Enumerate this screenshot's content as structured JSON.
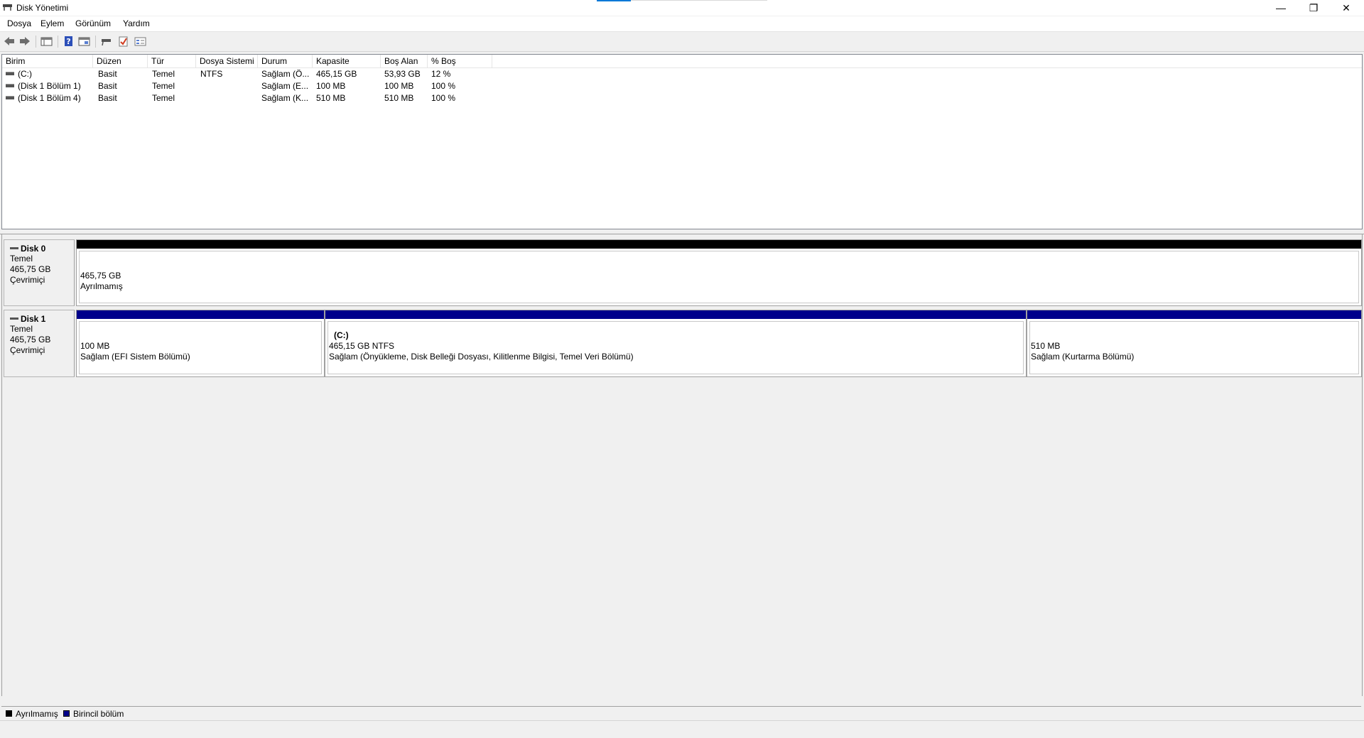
{
  "window": {
    "title": "Disk Yönetimi",
    "buttons": {
      "minimize": "—",
      "restore": "❐",
      "close": "✕"
    }
  },
  "menu": {
    "items": [
      "Dosya",
      "Eylem",
      "Görünüm",
      "Yardım"
    ]
  },
  "toolbar": {
    "icons": [
      "back-icon",
      "forward-icon",
      "console-tree-icon",
      "help-icon",
      "properties-icon",
      "connect-disk-icon",
      "check-icon",
      "settings-icon"
    ]
  },
  "volumes": {
    "columns": [
      "Birim",
      "Düzen",
      "Tür",
      "Dosya Sistemi",
      "Durum",
      "Kapasite",
      "Boş Alan",
      "% Boş"
    ],
    "rows": [
      [
        "(C:)",
        "Basit",
        "Temel",
        "NTFS",
        "Sağlam (Ö...",
        "465,15 GB",
        "53,93 GB",
        "12 %"
      ],
      [
        "(Disk 1 Bölüm 1)",
        "Basit",
        "Temel",
        "",
        "Sağlam (E...",
        "100 MB",
        "100 MB",
        "100 %"
      ],
      [
        "(Disk 1 Bölüm 4)",
        "Basit",
        "Temel",
        "",
        "Sağlam (K...",
        "510 MB",
        "510 MB",
        "100 %"
      ]
    ]
  },
  "disks": [
    {
      "name": "Disk 0",
      "type": "Temel",
      "size": "465,75 GB",
      "status": "Çevrimiçi",
      "partitions": [
        {
          "label": "",
          "size": "465,75 GB",
          "status": "Ayrılmamış"
        }
      ]
    },
    {
      "name": "Disk 1",
      "type": "Temel",
      "size": "465,75 GB",
      "status": "Çevrimiçi",
      "partitions": [
        {
          "label": "",
          "size": "100 MB",
          "status": "Sağlam (EFI Sistem Bölümü)"
        },
        {
          "label": "(C:)",
          "size": "465,15 GB NTFS",
          "status": "Sağlam (Önyükleme, Disk Belleği Dosyası, Kilitlenme Bilgisi, Temel Veri Bölümü)"
        },
        {
          "label": "",
          "size": "510 MB",
          "status": "Sağlam (Kurtarma Bölümü)"
        }
      ]
    }
  ],
  "legend": [
    {
      "label": "Ayrılmamış",
      "color": "#000000"
    },
    {
      "label": "Birincil bölüm",
      "color": "#00008b"
    }
  ],
  "colors": {
    "unallocated": "#000000",
    "primary": "#00008b",
    "accent": "#0078d7"
  }
}
